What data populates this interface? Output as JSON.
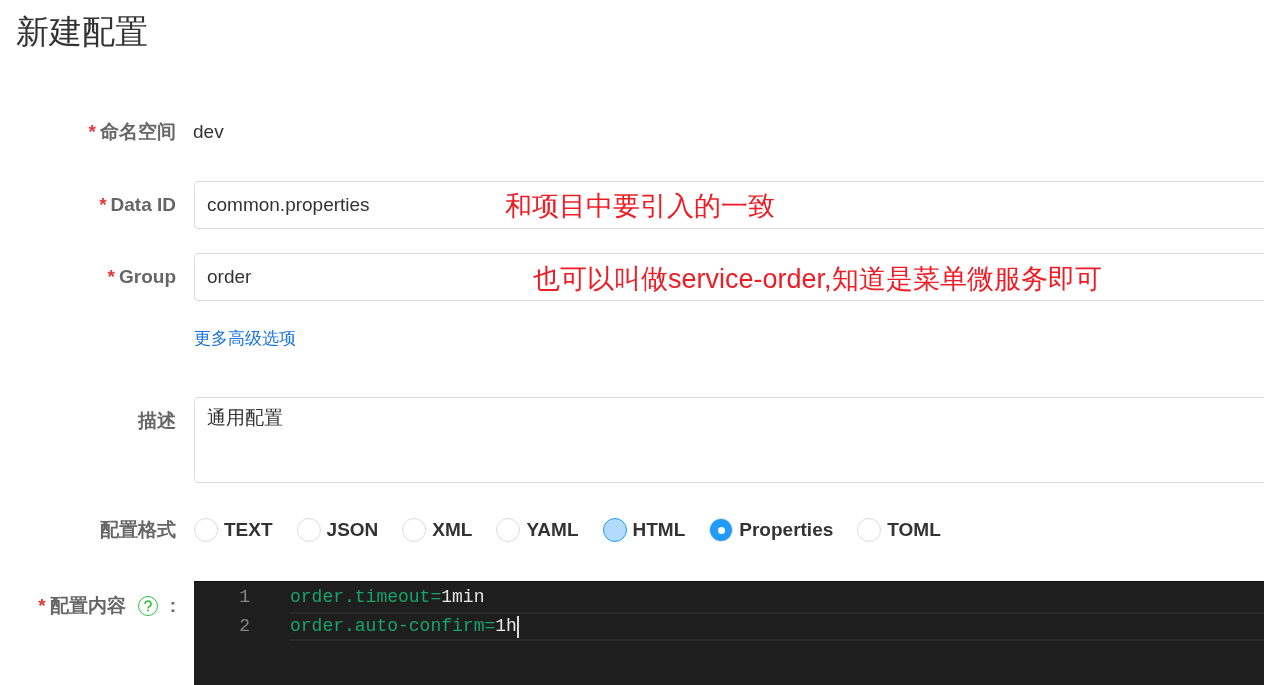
{
  "page_title": "新建配置",
  "namespace": {
    "label": "命名空间",
    "required_mark": "*",
    "value": "dev"
  },
  "data_id": {
    "label": "Data ID",
    "required_mark": "*",
    "value": "common.properties",
    "annotation": "和项目中要引入的一致"
  },
  "group": {
    "label": "Group",
    "required_mark": "*",
    "value": "order",
    "annotation": "也可以叫做service-order,知道是菜单微服务即可"
  },
  "advanced_link": "更多高级选项",
  "description": {
    "label": "描述",
    "value": "通用配置"
  },
  "format": {
    "label": "配置格式",
    "options": [
      {
        "label": "TEXT",
        "selected": false,
        "hovered": false
      },
      {
        "label": "JSON",
        "selected": false,
        "hovered": false
      },
      {
        "label": "XML",
        "selected": false,
        "hovered": false
      },
      {
        "label": "YAML",
        "selected": false,
        "hovered": false
      },
      {
        "label": "HTML",
        "selected": false,
        "hovered": true
      },
      {
        "label": "Properties",
        "selected": true,
        "hovered": false
      },
      {
        "label": "TOML",
        "selected": false,
        "hovered": false
      }
    ]
  },
  "content": {
    "label": "配置内容",
    "required_mark": "*",
    "colon": ":",
    "lines": [
      {
        "number": "1",
        "key": "order.timeout=",
        "value": "1min",
        "current": false
      },
      {
        "number": "2",
        "key": "order.auto-confirm=",
        "value": "1h",
        "current": true
      }
    ]
  }
}
